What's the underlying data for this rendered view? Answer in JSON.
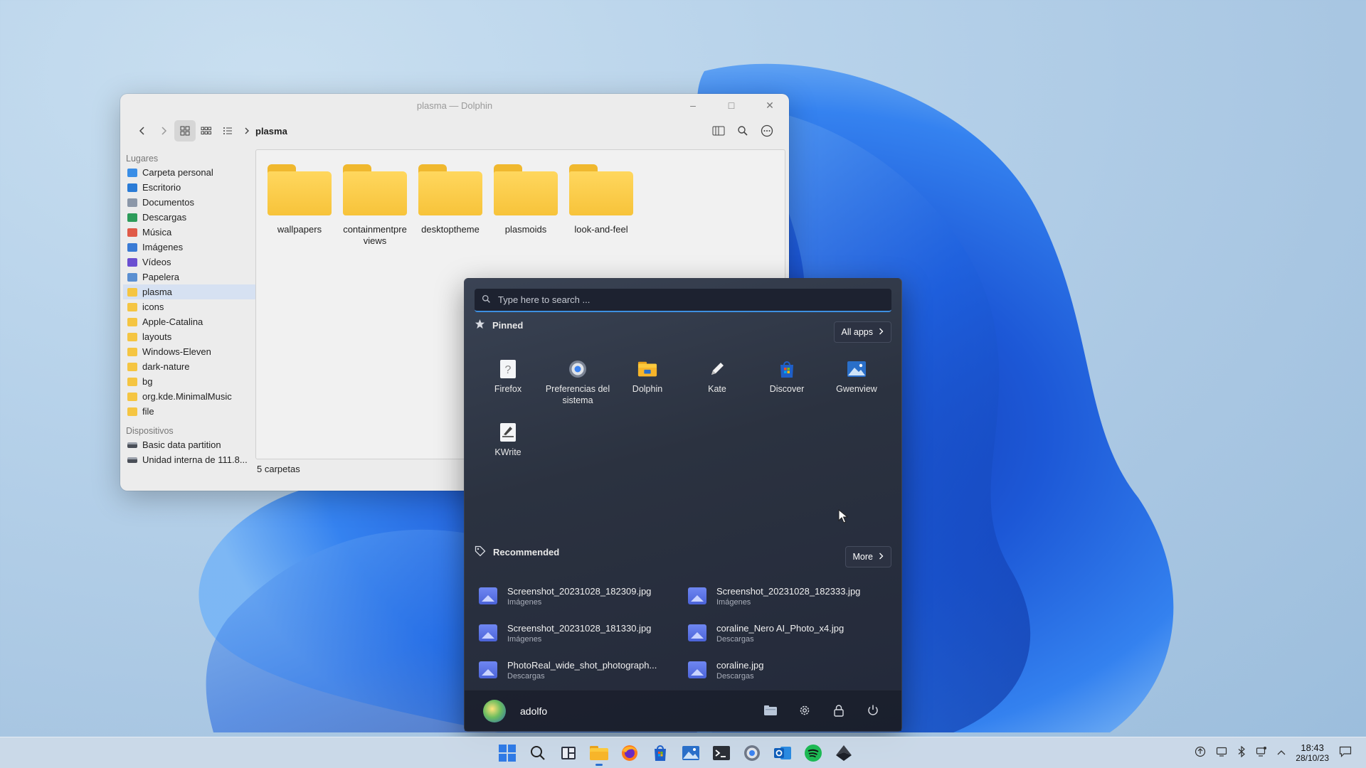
{
  "dolphin": {
    "title": "plasma — Dolphin",
    "breadcrumb": "plasma",
    "places_header": "Lugares",
    "places": [
      {
        "label": "Carpeta personal",
        "icon": "home-folder-icon",
        "color": "#3a8ee6"
      },
      {
        "label": "Escritorio",
        "icon": "desktop-icon",
        "color": "#2a7bd6"
      },
      {
        "label": "Documentos",
        "icon": "documents-icon",
        "color": "#8b97a8"
      },
      {
        "label": "Descargas",
        "icon": "download-icon",
        "color": "#2d9c5a"
      },
      {
        "label": "Música",
        "icon": "music-icon",
        "color": "#e05a48"
      },
      {
        "label": "Imágenes",
        "icon": "pictures-icon",
        "color": "#3a7bd5"
      },
      {
        "label": "Vídeos",
        "icon": "videos-icon",
        "color": "#6a4fd1"
      },
      {
        "label": "Papelera",
        "icon": "trash-icon",
        "color": "#5a8fd1"
      },
      {
        "label": "plasma",
        "icon": "folder-icon",
        "color": "#f5c542",
        "selected": true
      },
      {
        "label": "icons",
        "icon": "folder-icon",
        "color": "#f5c542"
      },
      {
        "label": "Apple-Catalina",
        "icon": "folder-icon",
        "color": "#f5c542"
      },
      {
        "label": "layouts",
        "icon": "folder-icon",
        "color": "#f5c542"
      },
      {
        "label": "Windows-Eleven",
        "icon": "folder-icon",
        "color": "#f5c542"
      },
      {
        "label": "dark-nature",
        "icon": "folder-icon",
        "color": "#f5c542"
      },
      {
        "label": "bg",
        "icon": "folder-icon",
        "color": "#f5c542"
      },
      {
        "label": "org.kde.MinimalMusic",
        "icon": "folder-icon",
        "color": "#f5c542"
      },
      {
        "label": "file",
        "icon": "folder-icon",
        "color": "#f5c542"
      }
    ],
    "devices_header": "Dispositivos",
    "devices": [
      {
        "label": "Basic data partition",
        "icon": "drive-icon"
      },
      {
        "label": "Unidad interna de 111.8...",
        "icon": "drive-icon"
      }
    ],
    "folders": [
      "wallpapers",
      "containmentpreviews",
      "desktoptheme",
      "plasmoids",
      "look-and-feel"
    ],
    "status": "5 carpetas"
  },
  "start_menu": {
    "search_placeholder": "Type here to search ...",
    "pinned_label": "Pinned",
    "all_apps_label": "All apps",
    "pinned_apps": [
      {
        "label": "Firefox",
        "icon": "unknown-app-icon"
      },
      {
        "label": "Preferencias del sistema",
        "icon": "system-settings-icon"
      },
      {
        "label": "Dolphin",
        "icon": "dolphin-folder-icon"
      },
      {
        "label": "Kate",
        "icon": "kate-pen-icon"
      },
      {
        "label": "Discover",
        "icon": "discover-store-icon"
      },
      {
        "label": "Gwenview",
        "icon": "gwenview-image-icon"
      },
      {
        "label": "KWrite",
        "icon": "kwrite-icon"
      }
    ],
    "recommended_label": "Recommended",
    "more_label": "More",
    "recommended": [
      {
        "name": "Screenshot_20231028_182309.jpg",
        "location": "Imágenes"
      },
      {
        "name": "Screenshot_20231028_182333.jpg",
        "location": "Imágenes"
      },
      {
        "name": "Screenshot_20231028_181330.jpg",
        "location": "Imágenes"
      },
      {
        "name": "coraline_Nero AI_Photo_x4.jpg",
        "location": "Descargas"
      },
      {
        "name": "PhotoReal_wide_shot_photograph...",
        "location": "Descargas"
      },
      {
        "name": "coraline.jpg",
        "location": "Descargas"
      }
    ],
    "user": "adolfo"
  },
  "taskbar": {
    "apps": [
      "start-icon",
      "search-icon",
      "widgets-icon",
      "file-manager-icon",
      "firefox-icon",
      "discover-icon",
      "gwenview-icon",
      "terminal-icon",
      "settings-icon",
      "outlook-icon",
      "spotify-icon",
      "kde-icon"
    ],
    "time": "18:43",
    "date": "28/10/23"
  },
  "colors": {
    "accent": "#3d8fe0",
    "folder": "#f5c542"
  }
}
